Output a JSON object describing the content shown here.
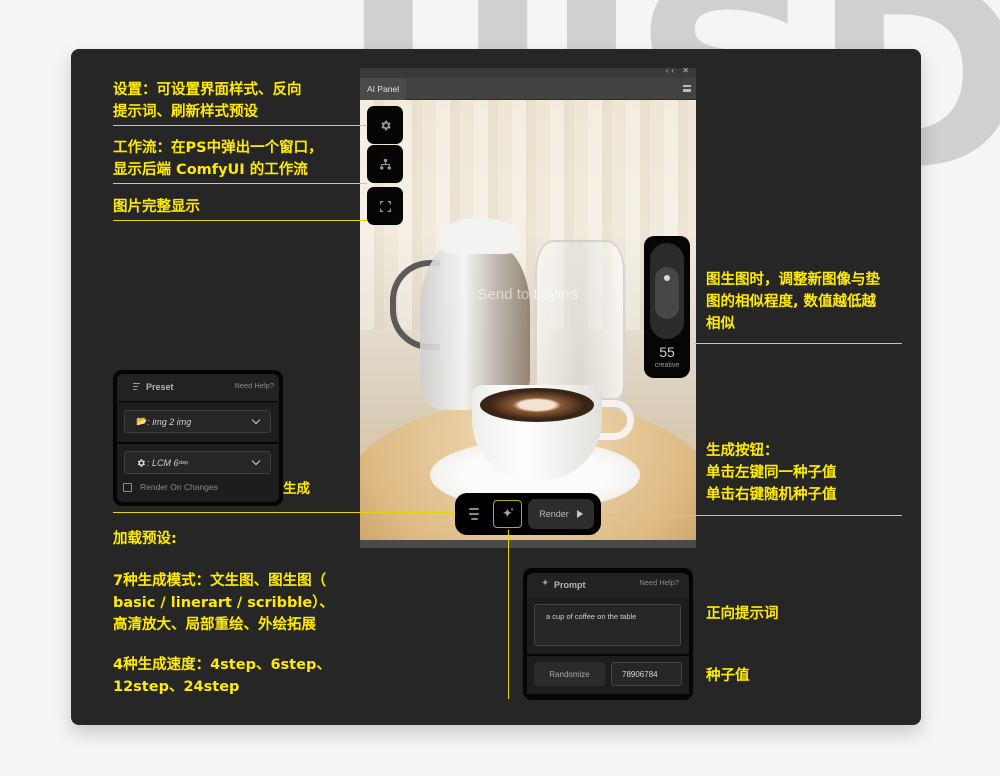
{
  "watermark": "UISDC",
  "annotations": {
    "settings": "设置：可设置界面样式、反向\n提示词、刷新样式预设",
    "workflow": "工作流：在PS中弹出一个窗口，\n显示后端 ComfyUI 的工作流",
    "fit_image": "图片完整显示",
    "strength": "图生图时，调整新图像与垫\n图的相似程度, 数值越低越\n相似",
    "render": "生成按钮：\n单击左键同一种子值\n单击右键随机种子值",
    "realtime": "开启实时生成",
    "load_preset": "加载预设:",
    "modes": "7种生成模式：文生图、图生图（\nbasic / linerart / scribble）、\n高清放大、局部重绘、外绘拓展",
    "speeds": "4种生成速度：4step、6step、\n12step、24step",
    "positive_prompt": "正向提示词",
    "seed": "种子值"
  },
  "ps_panel": {
    "window_controls": "‹‹ ✕",
    "tab_label": "AI Panel",
    "menu_icon": "hamburger-icon",
    "canvas_overlay_text": "Send to Layers",
    "tool_buttons": [
      {
        "icon": "gear-icon",
        "label": "settings"
      },
      {
        "icon": "workflow-icon",
        "label": "workflow"
      },
      {
        "icon": "fullscreen-icon",
        "label": "fit image"
      }
    ],
    "strength": {
      "value": "55",
      "label": "creative",
      "level_percent": 55
    }
  },
  "render_bar": {
    "list_icon": "list-icon",
    "generate_icon": "sparkle-icon",
    "render_label": "Render",
    "play_icon": "play-icon"
  },
  "preset_panel": {
    "title": "Preset",
    "help": "Need Help?",
    "mode_select": {
      "icon": "📂",
      "value": ": img 2 img"
    },
    "speed_select": {
      "icon": "gear-icon",
      "value": ": LCM 6",
      "superscript": "step"
    },
    "render_on_changes": {
      "label": "Render On Changes",
      "checked": false
    }
  },
  "prompt_panel": {
    "title": "Prompt",
    "help": "Need Help?",
    "prompt_value": "a cup of coffee on the table",
    "randomize_label": "Randomize",
    "seed_value": "78906784"
  }
}
